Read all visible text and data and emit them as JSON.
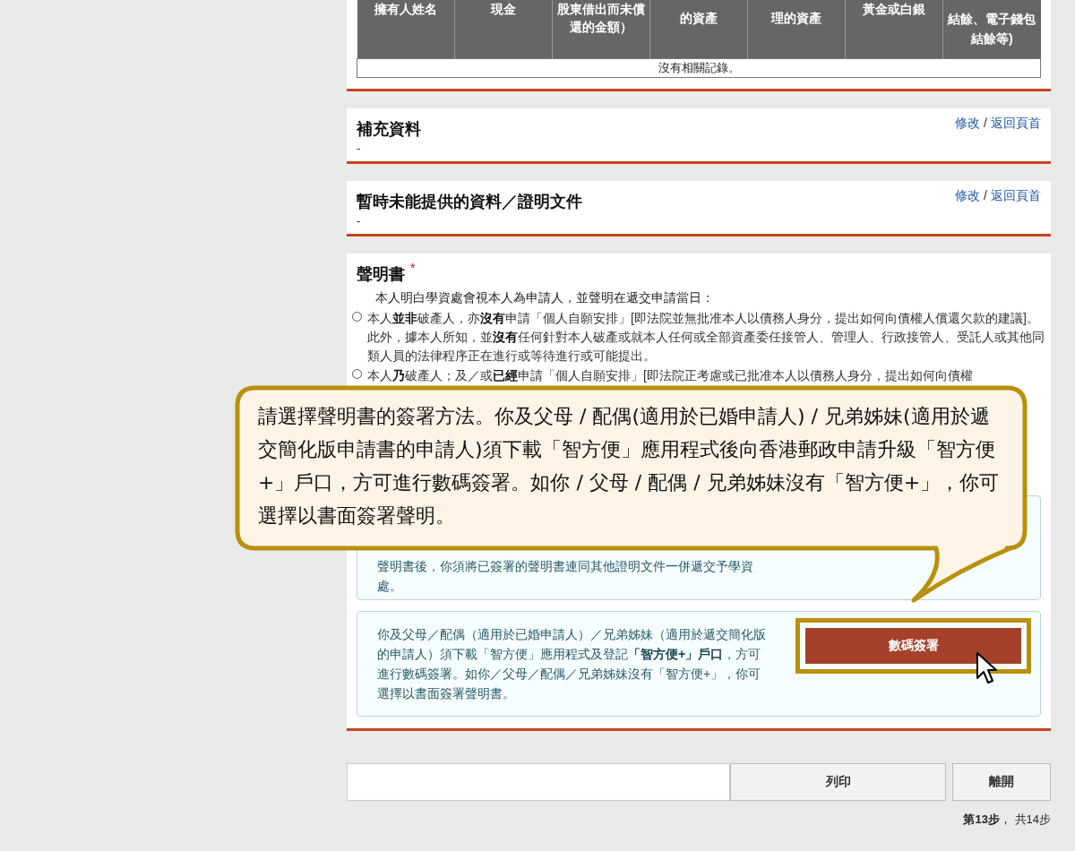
{
  "table": {
    "columns": [
      "擁有人姓名",
      "現金",
      "股東借出而未償還的金額）",
      "的資產",
      "理的資產",
      "黃金或白銀",
      "結餘、電子錢包結餘等)"
    ],
    "empty_message": "沒有相關記錄。"
  },
  "sections": [
    {
      "title": "補充資料",
      "links": [
        "修改",
        "返回頁首"
      ],
      "separator": "/",
      "value": "-"
    },
    {
      "title": "暫時未能提供的資料／證明文件",
      "links": [
        "修改",
        "返回頁首"
      ],
      "separator": "/",
      "value": "-"
    }
  ],
  "declaration": {
    "title": "聲明書",
    "required_mark": "*",
    "intro": "本人明白學資處會視本人為申請人，並聲明在遞交申請當日：",
    "options": [
      {
        "text": "本人**並非**破產人，亦**沒有**申請「個人自願安排」[即法院並無批准本人以債務人身分，提出如何向債權人償還欠款的建議]。此外，據本人所知，並**沒有**任何針對本人破產或就本人任何或全部資產委任接管人、管理人、行政接管人、受託人或其他同類人員的法律程序正在進行或等待進行或可能提出。",
        "selected": false
      },
      {
        "text": "本人**乃**破產人；及／或**已經**申請「個人自願安排」[即法院正考慮或已批准本人以債務人身分，提出如何向債權",
        "selected": false
      }
    ],
    "paper_box": {
      "text": "聲明書後，你須將已簽署的聲明書連同其他證明文件一併遞交予學資處。"
    },
    "digital_box": {
      "text": "你及父母／配偶（適用於已婚申請人）／兄弟姊妹（適用於遞交簡化版的申請人）須下載「智方便」應用程式及登記**「智方便+」戶口**，方可進行數碼簽署。如你／父母／配偶／兄弟姊妹沒有「智方便+」，你可選擇以書面簽署聲明書。",
      "button": {
        "label": "數碼簽署",
        "highlighted": true
      }
    }
  },
  "footer": {
    "buttons": [
      "列印",
      "離開"
    ],
    "step": "**第13步**， 共14步"
  },
  "callout": {
    "text": "請選擇聲明書的簽署方法。你及父母 / 配偶(適用於已婚申請人) / 兄弟姊妹(適用於遞交簡化版申請書的申請人)須下載「智方便」應用程式後向香港郵政申請升級「智方便+」戶口，方可進行數碼簽署。如你 / 父母 / 配偶 / 兄弟姊妹沒有「智方便+」，你可選擇以書面簽署聲明。"
  }
}
